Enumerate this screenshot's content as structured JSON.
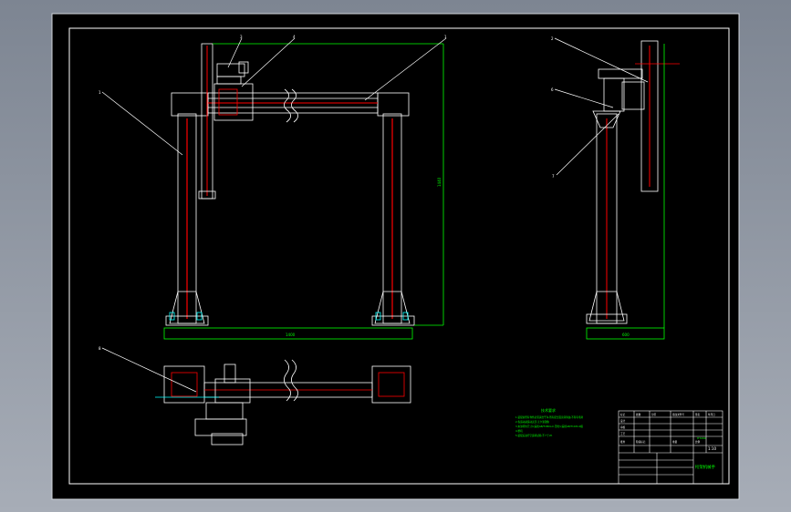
{
  "part_labels": {
    "front": [
      "1",
      "3",
      "4",
      "1"
    ],
    "side": [
      "2",
      "6",
      "7"
    ],
    "top": [
      "8"
    ]
  },
  "dimensions": {
    "height": "1440",
    "width_front": "1400",
    "width_side": "600"
  },
  "notes": {
    "heading": "技术要求",
    "lines": [
      "1.装配前所有零件必须清洗干净,所有配合面涂润滑油,不得有毛刺",
      "2.各运动副运动灵活,无卡滞现象",
      "3.未注明的尺寸公差按GB/T1804-m,形位公差按GB/T1184-K级",
      "4.整机",
      "5.装配后进行空运转试验,不少于2h"
    ]
  },
  "title_block": {
    "scale": "1:10",
    "drawing_name": "桁架机械手",
    "material": "HT200",
    "cells": [
      "标记",
      "处数",
      "分区",
      "更改文件号",
      "签名",
      "年月日",
      "设计",
      "审核",
      "工艺",
      "批准",
      "阶段标记",
      "重量",
      "比例"
    ]
  },
  "colors": {
    "background": "#000000",
    "frame": "#ffffff",
    "outline": "#ffffff",
    "dimension": "#00ff00",
    "centerline": "#ff0000",
    "accent": "#00ffff",
    "leader": "#ffffff"
  }
}
